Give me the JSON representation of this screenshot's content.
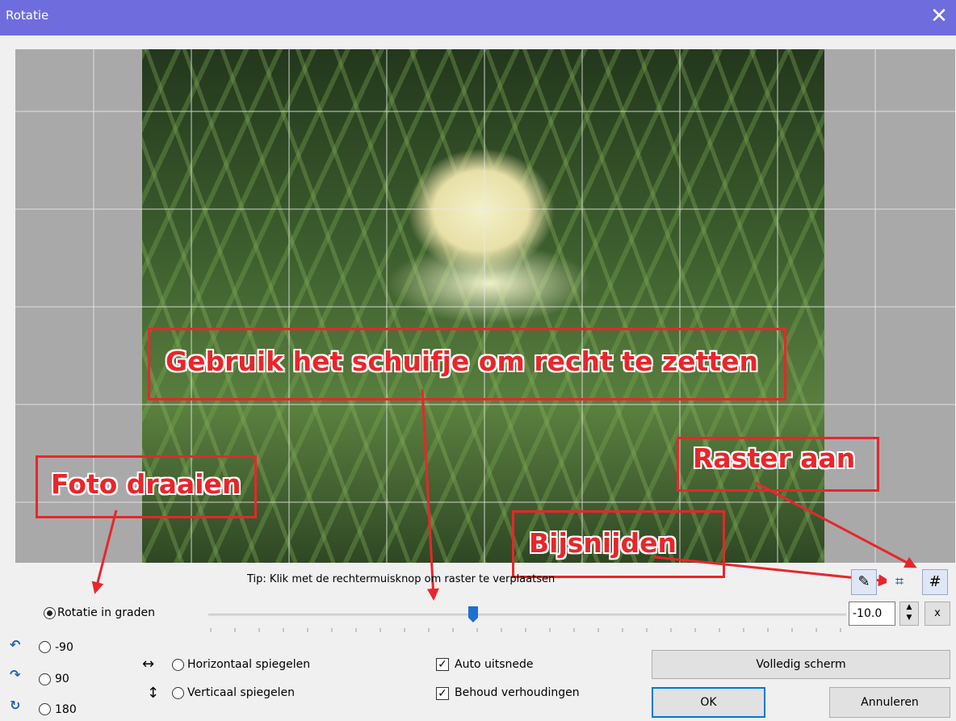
{
  "window": {
    "title": "Rotatie",
    "close_icon": "close-icon"
  },
  "annotations": {
    "slider_hint": "Gebruik het schuifje om recht te zetten",
    "rotate_hint": "Foto draaien",
    "grid_hint": "Raster aan",
    "crop_hint": "Bijsnijden",
    "color": "#e8262b"
  },
  "tip": "Tip: Klik met de rechtermuisknop om raster te verplaatsen",
  "rotation": {
    "mode_label": "Rotatie in graden",
    "value": "-10.0",
    "reset_label": "x",
    "options": [
      {
        "label": "-90",
        "icon": "rotate-left-icon"
      },
      {
        "label": "90",
        "icon": "rotate-right-icon"
      },
      {
        "label": "180",
        "icon": "rotate-180-icon"
      }
    ]
  },
  "mirror": {
    "horizontal_label": "Horizontaal spiegelen",
    "vertical_label": "Verticaal spiegelen"
  },
  "checks": {
    "auto_crop_label": "Auto uitsnede",
    "auto_crop_checked": true,
    "keep_ratio_label": "Behoud verhoudingen",
    "keep_ratio_checked": true
  },
  "buttons": {
    "fullscreen": "Volledig scherm",
    "ok": "OK",
    "cancel": "Annuleren"
  },
  "tools": [
    {
      "icon": "straighten-pen-icon"
    },
    {
      "icon": "crop-icon"
    },
    {
      "icon": "grid-icon"
    }
  ],
  "accent_color": "#0078d7",
  "titlebar_color": "#6f6ddd"
}
